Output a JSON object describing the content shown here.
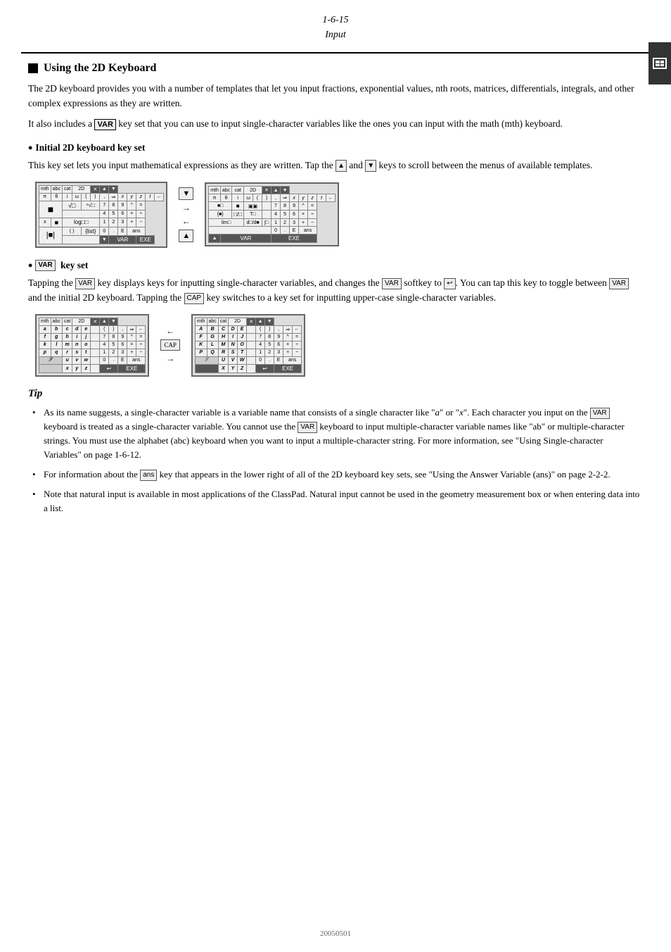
{
  "header": {
    "line1": "1-6-15",
    "line2": "Input"
  },
  "section": {
    "title": "Using the 2D Keyboard",
    "intro1": "The 2D keyboard provides you with a number of templates that let you input fractions, exponential values, nth roots, matrices, differentials, integrals, and other complex expressions as they are written.",
    "intro2_pre": "It also includes a ",
    "var_label": "VAR",
    "intro2_post": " key set that you can use to input single-character variables like the ones you can input with the math (mth) keyboard.",
    "sub1_title": "Initial 2D keyboard key set",
    "sub1_body": "This key set lets you input mathematical expressions as they are written. Tap the",
    "sub1_body2": "and",
    "sub1_body3": "keys to scroll between the menus of available templates.",
    "sub2_title": "VAR key set",
    "sub2_body1": "Tapping the",
    "sub2_body2": "VAR",
    "sub2_body3": "key displays keys for inputting single-character variables, and changes the",
    "sub2_body4": "VAR",
    "sub2_body5": "softkey to",
    "sub2_body6": ". You can tap this key to toggle between",
    "sub2_body7": "VAR",
    "sub2_body8": "and the initial 2D keyboard.",
    "sub2_body9": "Tapping the",
    "sub2_body10": "CAP",
    "sub2_body11": "key switches to a key set for inputting upper-case single-character variables."
  },
  "tip": {
    "heading": "Tip",
    "bullets": [
      "As its name suggests, a single-character variable is a variable name that consists of a single character like \"a\" or \"x\". Each character you input on the VAR keyboard is treated as a single-character variable. You cannot use the VAR keyboard to input multiple-character variable names like \"ab\" or multiple-character strings. You must use the alphabet (abc) keyboard when you want to input a multiple-character string. For more information, see \"Using Single-character Variables\" on page 1-6-12.",
      "For information about the ans key that appears in the lower right of all of the 2D keyboard key sets, see \"Using the Answer Variable (ans)\" on page 2-2-2.",
      "Note that natural input is available in most applications of the ClassPad. Natural input cannot be used in the geometry measurement box or when entering data into a list."
    ]
  },
  "footer": {
    "text": "20050501"
  }
}
